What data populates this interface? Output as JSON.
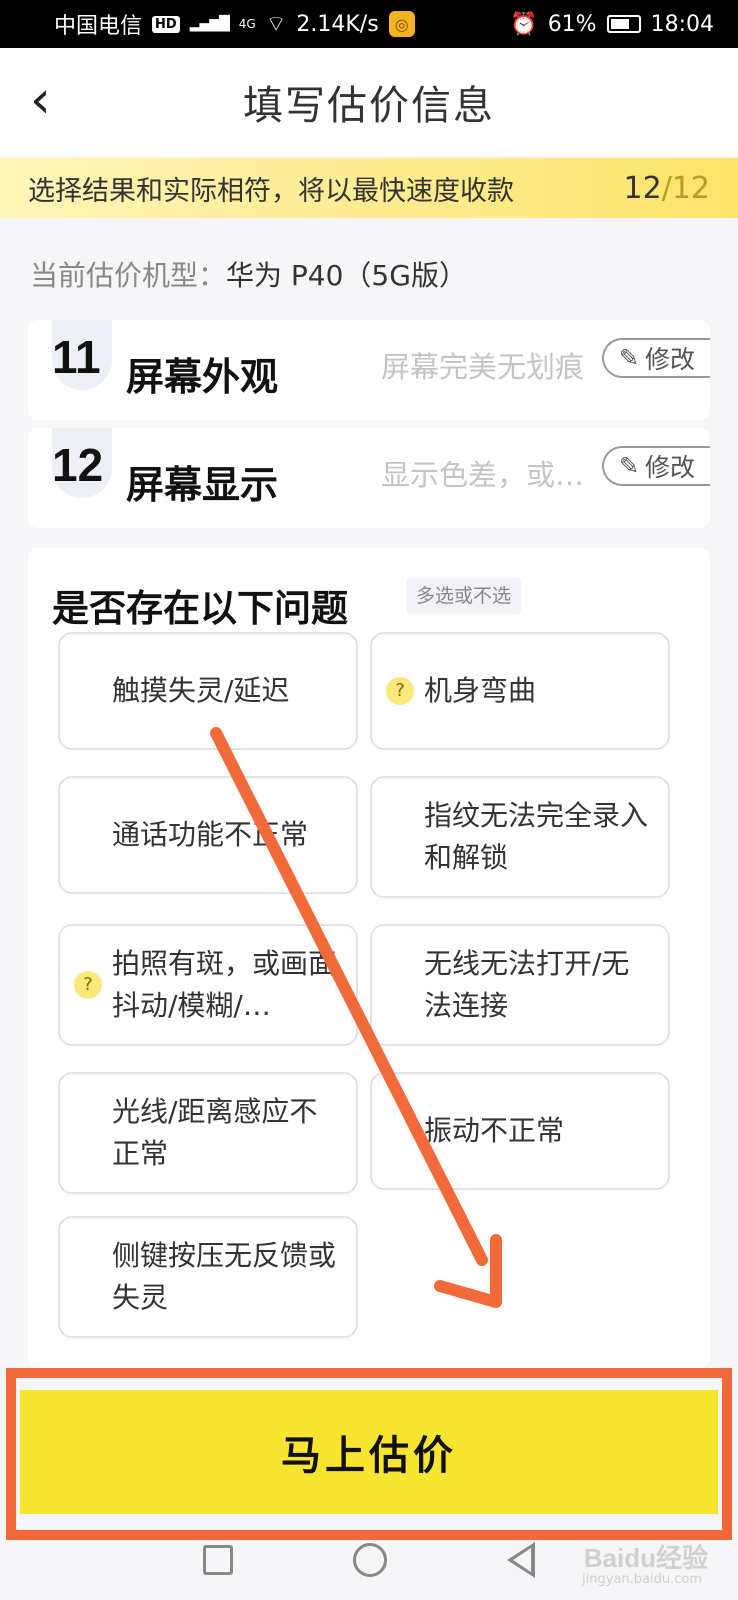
{
  "status_bar": {
    "carrier": "中国电信",
    "hd": "HD",
    "network": "4G",
    "speed": "2.14K/s",
    "battery": "61%",
    "time": "18:04"
  },
  "header": {
    "back_glyph": "‹",
    "title": "填写估价信息"
  },
  "notice": {
    "text": "选择结果和实际相符，将以最快速度收款",
    "progress_current": "12",
    "progress_total": "/12"
  },
  "model": {
    "label": "当前估价机型：",
    "value": "华为 P40（5G版）"
  },
  "answered": [
    {
      "num": "11",
      "title": "屏幕外观",
      "answer": "屏幕完美无划痕",
      "edit_label": "修改"
    },
    {
      "num": "12",
      "title": "屏幕显示",
      "answer": "显示色差，或…",
      "edit_label": "修改"
    }
  ],
  "problems": {
    "title": "是否存在以下问题",
    "tag": "多选或不选",
    "options": [
      {
        "label": "触摸失灵/延迟"
      },
      {
        "label": "机身弯曲"
      },
      {
        "label": "通话功能不正常"
      },
      {
        "label": "指纹无法完全录入和解锁"
      },
      {
        "label": "拍照有斑，或画面抖动/模糊/…"
      },
      {
        "label": "无线无法打开/无法连接"
      },
      {
        "label": "光线/距离感应不正常"
      },
      {
        "label": "振动不正常"
      },
      {
        "label": "侧键按压无反馈或失灵"
      }
    ]
  },
  "submit": {
    "label": "马上估价"
  },
  "watermark": {
    "text": "Baidu经验",
    "sub": "jingyan.baidu.com"
  },
  "colors": {
    "accent_yellow": "#f8e52f",
    "annotation_orange": "#f26a3a"
  },
  "icons": [
    "back-icon",
    "pencil-icon",
    "question-icon",
    "wifi-icon",
    "alarm-icon",
    "battery-icon"
  ]
}
